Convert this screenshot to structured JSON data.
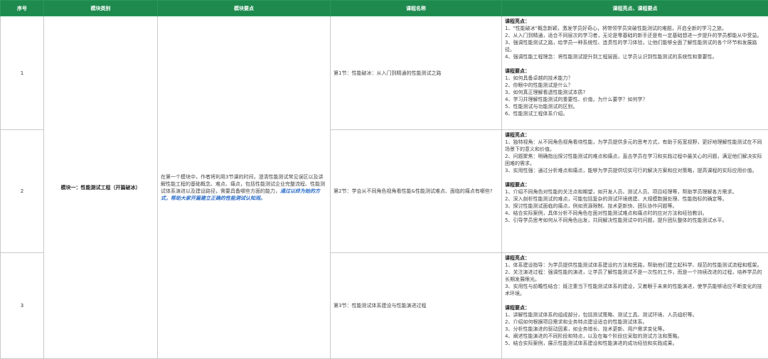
{
  "headers": [
    "序号",
    "模块类别",
    "模块要点",
    "课程名称",
    "课程亮点、课程要点"
  ],
  "module": {
    "category": "模块一：性能测试工程（开篇破冰）",
    "points_text": "在第一个模块中，作者将利用3节课的时间，澄清性能测试常见误区以及讲解性能工程的基础概念、难点、痛点，包括性能测试企业完整流程、性能测试体系演进以及建设路径，需要具备哪些方面的能力，",
    "points_highlight": "通过以终为始的方式，帮助大家开篇建立正确的性能测试认知观。"
  },
  "rows": [
    {
      "seq": "1",
      "course": "第1节：性能破冰：从入门到精通的性能测试之路",
      "highlights_title": "课程亮点：",
      "highlights": [
        "1、\"性能破冰\"概念新颖，激发学员好奇心，将带领学员突破性能测试的难题，开启全新的学习之旅。",
        "2、从入门到精通，适合不同层次的学习者，无论是零基础的新手还是有一定基础想进一步提升的学员都能从中受益。",
        "3、强调性能测试之路，给学员一种系统性、连贯性的学习体验，让他们能够全面了解性能测试的各个环节和发展路径。",
        "4、强调性能工程理念：将性能测试提升到工程层面，让学员认识到性能测试的系统性和重要性。"
      ],
      "points_title": "课程要点：",
      "points": [
        "1、如何具备卓越的技术能力？",
        "2、你眼中的性能测试是什么？",
        "3、如何真正理解看透性能测试本质?",
        "4、学习并理解性能测试的重要性、价值，为什么要学？如何学？",
        "5、性能测试与功能测试的区别。",
        "6、性能测试工程体系介绍。"
      ]
    },
    {
      "seq": "2",
      "course": "第2节：学会从不同角色视角看性能&性能测试难点、面临的痛点有哪些?",
      "highlights_title": "课程亮点：",
      "highlights": [
        "1、独特视角：从不同角色视角看待性能，为学员提供多元的思考方式，有助于拓宽视野，更好地理解性能测试在不同场景下的意义和价值。",
        "2、问题聚焦：明确指出探讨性能测试的难点和痛点，直击学员在学习和实践过程中最关心的问题，满足他们解决实际困难的需求。",
        "3、实用性强：通过分析难点和痛点，能够为学员提供切实可行的解决方案和应对策略，提高课程的实际应用价值。"
      ],
      "points_title": "课程要点：",
      "points": [
        "1、介绍不同角色对性能的关注点和期望，如开发人员、测试人员、项目经理等，帮助学员理解各方需求。",
        "2、深入剖析性能测试的难点，可能包括复杂的测试环境搭建、大规模数据处理、性能指标的确定等。",
        "3、探讨性能测试面临的痛点，例如资源限制、技术更新快、团队协作问题等。",
        "4、结合实际案例，具体分析不同角色在面对性能测试难点和痛点时的应对方法和经验教训。",
        "5、引导学员思考如何从不同角色出发，共同解决性能测试中的问题，提升团队整体的性能测试水平。"
      ]
    },
    {
      "seq": "3",
      "course": "第3节：性能测试体系建设与性能演进过程",
      "highlights_title": "课程亮点：",
      "highlights": [
        "1、体系建设指导：为学员提供性能测试体系建设的方法和思路，帮助他们建立起科学、规范的性能测试流程和框架。",
        "2、关注演进过程：强调性能的演进，让学员了解性能测试不是一次性的工作，而是一个持续改进的过程，培养学员的长期发展眼光。",
        "3、实用性与前瞻性结合：既注重当下性能测试体系的建设，又着眼于未来的性能演进，使学员能够适应不断变化的技术环境。"
      ],
      "points_title": "课程要点：",
      "points": [
        "1、讲解性能测试体系的组成部分，包括测试策略、测试工具、测试环境、人员组织等。",
        "2、介绍如何根据项目需求和业务特点建设适合的性能测试体系。",
        "3、分析性能演进的驱动因素，如业务增长、技术更新、用户需求变化等。",
        "4、阐述性能演进的不同阶段和特点，以及在每个阶段应采取的测试方法和策略。",
        "5、结合实际案例，展示性能测试体系建设和性能演进的成功经验和实践成果。"
      ]
    }
  ]
}
